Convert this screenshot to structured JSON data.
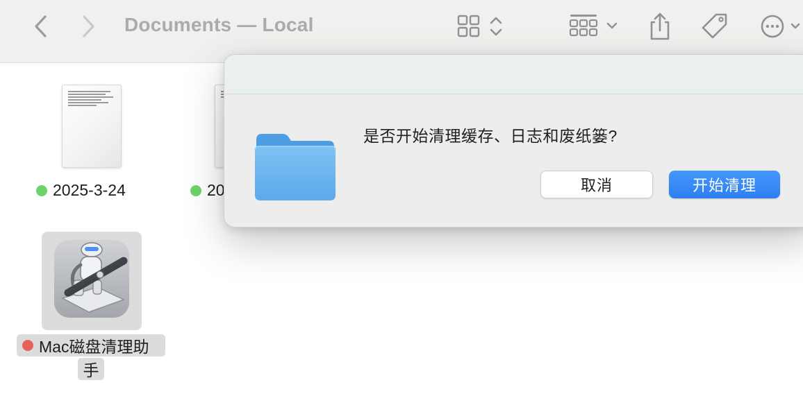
{
  "window": {
    "title": "Documents — Local"
  },
  "toolbar": {
    "back_icon": "chevron-left-icon",
    "forward_icon": "chevron-right-icon",
    "view_icon": "grid-view-icon",
    "group_icon": "group-by-icon",
    "share_icon": "share-icon",
    "tag_icon": "tag-icon",
    "more_icon": "ellipsis-circle-icon"
  },
  "files": [
    {
      "name": "2025-3-24",
      "tag_color": "#6cd36a",
      "icon": "document-thumbnail"
    },
    {
      "name": "20",
      "tag_color": "#6cd36a",
      "icon": "document-thumbnail"
    },
    {
      "name_line1": "Mac磁盘清理助",
      "name_line2": "手",
      "tag_color": "#e5625b",
      "icon": "automator-robot-icon"
    }
  ],
  "dialog": {
    "message": "是否开始清理缓存、日志和废纸篓?",
    "cancel_label": "取消",
    "confirm_label": "开始清理",
    "icon": "folder-icon",
    "accent_color": "#2d7ff2"
  }
}
